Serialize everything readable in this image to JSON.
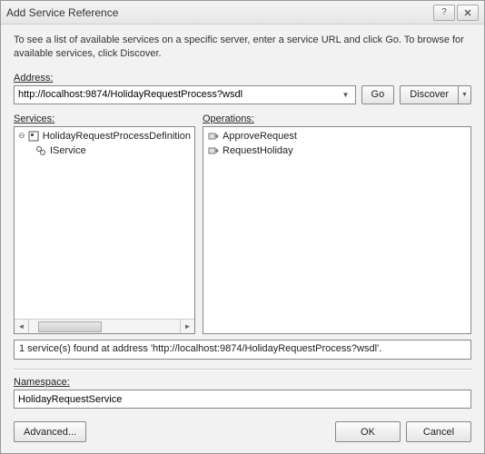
{
  "window": {
    "title": "Add Service Reference"
  },
  "instructions": "To see a list of available services on a specific server, enter a service URL and click Go. To browse for available services, click Discover.",
  "labels": {
    "address": "Address:",
    "services": "Services:",
    "operations": "Operations:",
    "namespace": "Namespace:"
  },
  "address": {
    "value": "http://localhost:9874/HolidayRequestProcess?wsdl"
  },
  "buttons": {
    "go": "Go",
    "discover": "Discover",
    "advanced": "Advanced...",
    "ok": "OK",
    "cancel": "Cancel"
  },
  "services_tree": {
    "root": "HolidayRequestProcessDefinition",
    "child": "IService"
  },
  "operations": {
    "items": [
      "ApproveRequest",
      "RequestHoliday"
    ]
  },
  "status": "1 service(s) found at address 'http://localhost:9874/HolidayRequestProcess?wsdl'.",
  "namespace": {
    "value": "HolidayRequestService"
  }
}
